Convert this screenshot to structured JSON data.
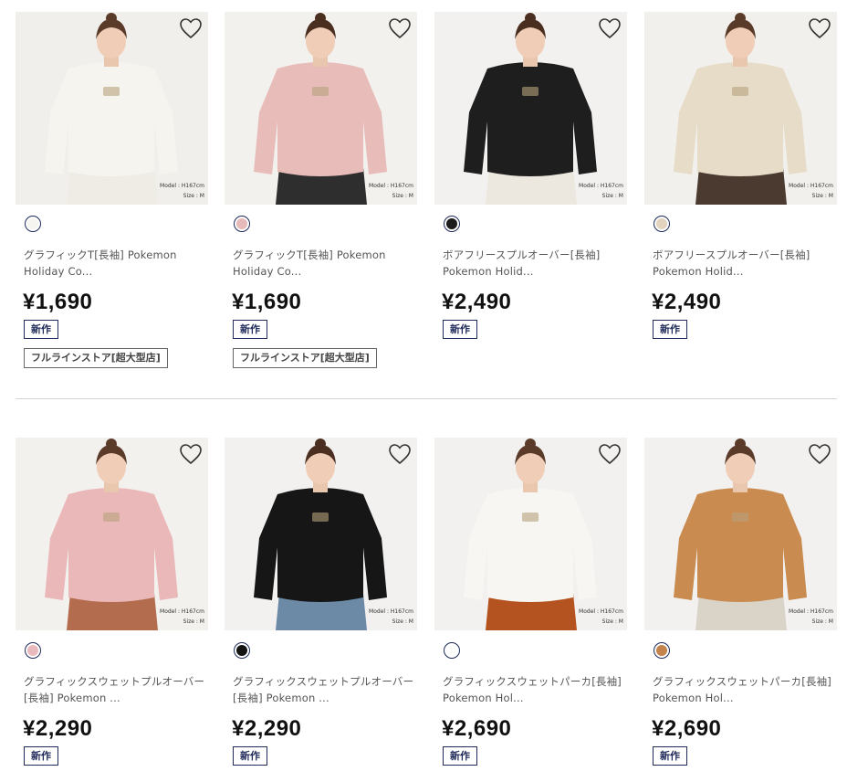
{
  "model_note": {
    "line1": "Model : H167cm",
    "line2": "Size : M"
  },
  "products": [
    {
      "name_line1": "グラフィックT[長袖] Pokemon",
      "name_line2": "Holiday Co...",
      "price": "¥1,690",
      "badge_new": "新作",
      "badge_store": "フルラインストア[超大型店]",
      "swatch_color": "#f7f5f0",
      "bg": "#f1efeb",
      "garment": "#f6f4ef",
      "bottom": "#efece6",
      "hair": "#5a3a28"
    },
    {
      "name_line1": "グラフィックT[長袖] Pokemon",
      "name_line2": "Holiday Co...",
      "price": "¥1,690",
      "badge_new": "新作",
      "badge_store": "フルラインストア[超大型店]",
      "swatch_color": "#e8b9b9",
      "bg": "#f3f1ee",
      "garment": "#e7bcb9",
      "bottom": "#2e2e2e",
      "hair": "#4a2e20"
    },
    {
      "name_line1": "ボアフリースプルオーバー[長袖]",
      "name_line2": "Pokemon Holid...",
      "price": "¥2,490",
      "badge_new": "新作",
      "badge_store": "",
      "swatch_color": "#1c1c1c",
      "bg": "#f2f1ef",
      "garment": "#1e1e1e",
      "bottom": "#ece8df",
      "hair": "#4a2e20"
    },
    {
      "name_line1": "ボアフリースプルオーバー[長袖]",
      "name_line2": "Pokemon Holid...",
      "price": "¥2,490",
      "badge_new": "新作",
      "badge_store": "",
      "swatch_color": "#e2d3bf",
      "bg": "#f2f0ec",
      "garment": "#e7dcc8",
      "bottom": "#4a3a30",
      "hair": "#5a3a28"
    },
    {
      "name_line1": "グラフィックスウェットプルオーバー",
      "name_line2": "[長袖] Pokemon ...",
      "price": "¥2,290",
      "badge_new": "新作",
      "badge_store": "",
      "swatch_color": "#e9b9bd",
      "bg": "#f3f1ee",
      "garment": "#eab8b9",
      "bottom": "#b36d4e",
      "hair": "#5a3a28"
    },
    {
      "name_line1": "グラフィックスウェットプルオーバー",
      "name_line2": "[長袖] Pokemon ...",
      "price": "¥2,290",
      "badge_new": "新作",
      "badge_store": "",
      "swatch_color": "#141414",
      "bg": "#f2f1ef",
      "garment": "#161616",
      "bottom": "#6c8aa6",
      "hair": "#4a2e20"
    },
    {
      "name_line1": "グラフィックスウェットパーカ[長袖]",
      "name_line2": "Pokemon Hol...",
      "price": "¥2,690",
      "badge_new": "新作",
      "badge_store": "",
      "swatch_color": "#ffffff",
      "bg": "#f2f1ef",
      "garment": "#f7f6f2",
      "bottom": "#b4531f",
      "hair": "#5a3a28"
    },
    {
      "name_line1": "グラフィックスウェットパーカ[長袖]",
      "name_line2": "Pokemon Hol...",
      "price": "¥2,690",
      "badge_new": "新作",
      "badge_store": "",
      "swatch_color": "#c4834a",
      "bg": "#f2f1ef",
      "garment": "#c98b50",
      "bottom": "#d9d3c8",
      "hair": "#5a3a28"
    }
  ]
}
